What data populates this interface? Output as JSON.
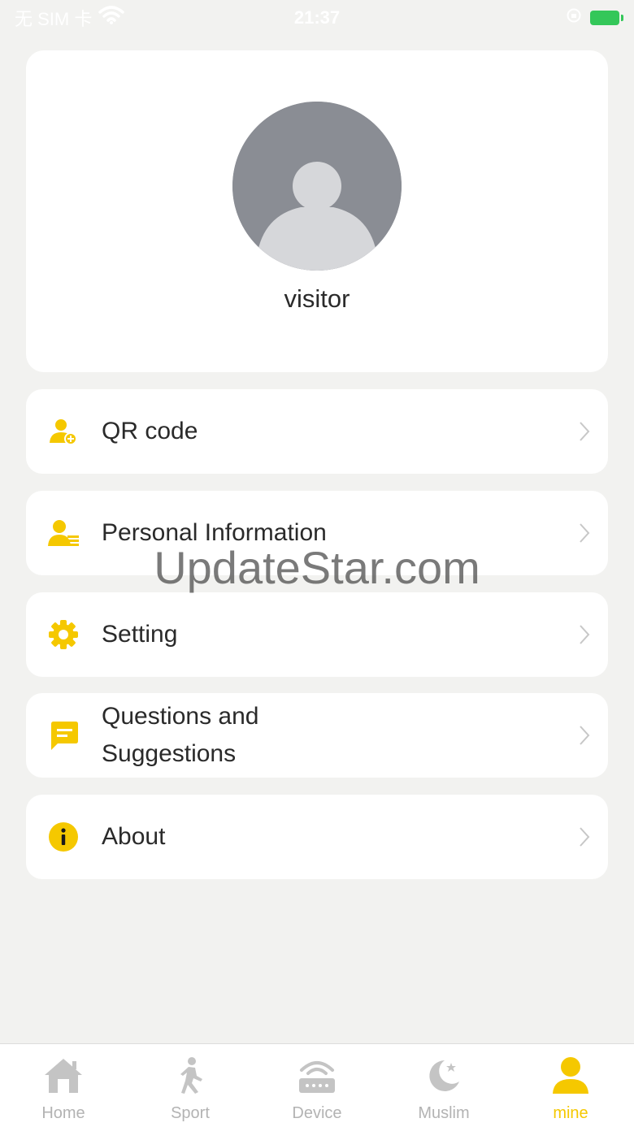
{
  "status_bar": {
    "carrier": "无 SIM 卡",
    "time": "21:37"
  },
  "profile": {
    "username": "visitor"
  },
  "menu": [
    {
      "label": "QR code",
      "icon": "add-user-icon"
    },
    {
      "label": "Personal Information",
      "icon": "id-card-icon"
    },
    {
      "label": "Setting",
      "icon": "gear-icon"
    },
    {
      "label": "Questions and Suggestions",
      "icon": "message-icon"
    },
    {
      "label": "About",
      "icon": "info-icon"
    }
  ],
  "watermark": "UpdateStar.com",
  "tabs": [
    {
      "label": "Home",
      "icon": "home-icon",
      "active": false
    },
    {
      "label": "Sport",
      "icon": "running-icon",
      "active": false
    },
    {
      "label": "Device",
      "icon": "device-icon",
      "active": false
    },
    {
      "label": "Muslim",
      "icon": "moon-icon",
      "active": false
    },
    {
      "label": "mine",
      "icon": "person-icon",
      "active": true
    }
  ],
  "colors": {
    "accent": "#f5c800",
    "background": "#f2f2f0",
    "avatar": "#8a8d94",
    "inactive_tab": "#b3b3b3"
  }
}
